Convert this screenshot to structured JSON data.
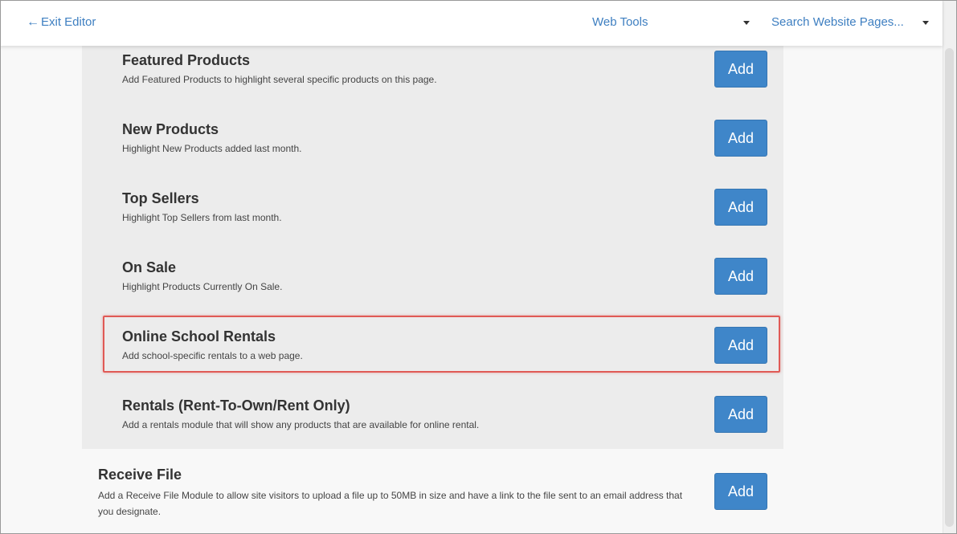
{
  "topbar": {
    "exit_label": "Exit Editor",
    "web_tools_label": "Web Tools",
    "search_pages_label": "Search Website Pages..."
  },
  "modules": [
    {
      "title": "Featured Products",
      "description": "Add Featured Products to highlight several specific products on this page.",
      "button": "Add"
    },
    {
      "title": "New Products",
      "description": "Highlight New Products added last month.",
      "button": "Add"
    },
    {
      "title": "Top Sellers",
      "description": "Highlight Top Sellers from last month.",
      "button": "Add"
    },
    {
      "title": "On Sale",
      "description": "Highlight Products Currently On Sale.",
      "button": "Add"
    },
    {
      "title": "Online School Rentals",
      "description": "Add school-specific rentals to a web page.",
      "button": "Add"
    },
    {
      "title": "Rentals (Rent-To-Own/Rent Only)",
      "description": "Add a rentals module that will show any products that are available for online rental.",
      "button": "Add"
    }
  ],
  "receive_file": {
    "title": "Receive File",
    "description": "Add a Receive File Module to allow site visitors to upload a file up to 50MB in size and have a link to the file sent to an email address that you designate.",
    "button": "Add"
  },
  "colors": {
    "link": "#3e7fc1",
    "button": "#3f86c9",
    "highlight": "#e05a56"
  }
}
